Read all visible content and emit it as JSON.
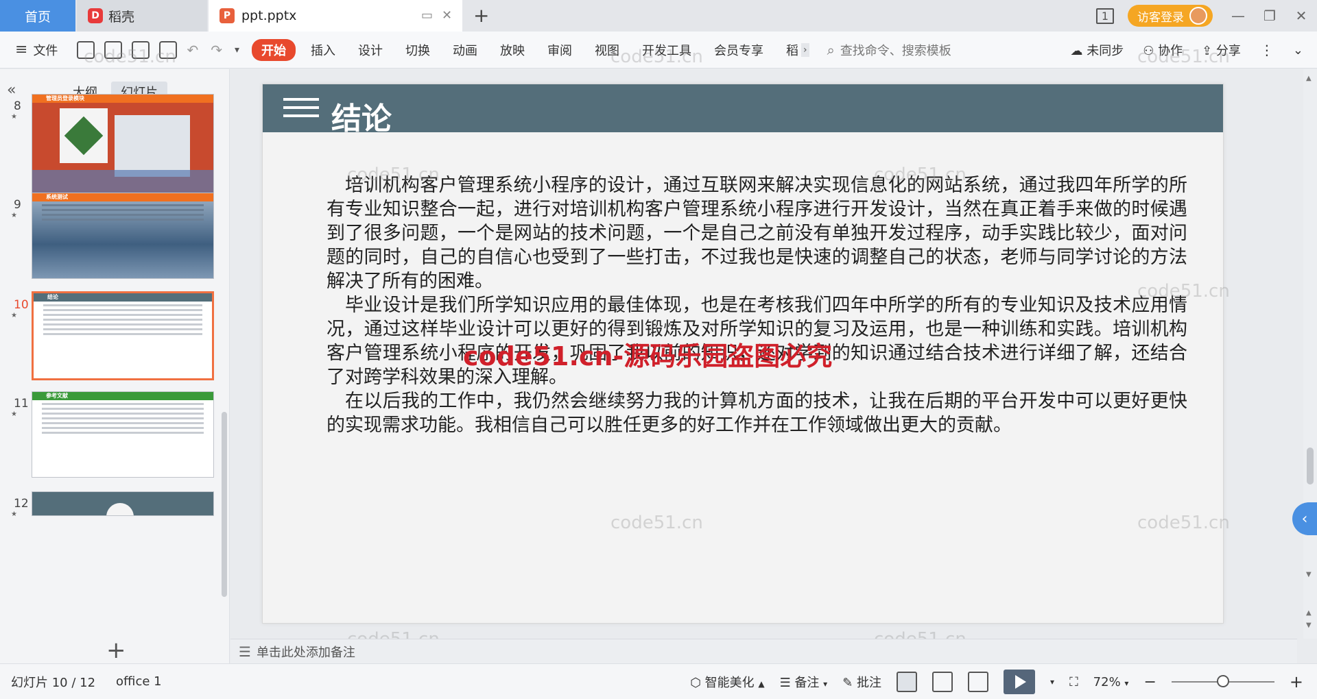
{
  "tabs": {
    "home": "首页",
    "daoke": "稻壳",
    "document": "ppt.pptx"
  },
  "titlebar": {
    "visitor_login": "访客登录",
    "page_indicator": "1"
  },
  "ribbon": {
    "file": "文件",
    "tabs": [
      "开始",
      "插入",
      "设计",
      "切换",
      "动画",
      "放映",
      "审阅",
      "视图",
      "开发工具",
      "会员专享",
      "稻"
    ],
    "search_placeholder": "查找命令、搜索模板",
    "sync": "未同步",
    "collab": "协作",
    "share": "分享"
  },
  "leftpanel": {
    "outline": "大纲",
    "slides": "幻灯片",
    "thumbs": [
      {
        "num": "8",
        "title": "管理员登录模块",
        "bar_color": "#f07020"
      },
      {
        "num": "9",
        "title": "系统测试",
        "bar_color": "#f07020"
      },
      {
        "num": "10",
        "title": "结论",
        "bar_color": "#546e7a"
      },
      {
        "num": "11",
        "title": "参考文献",
        "bar_color": "#3a9a3a"
      },
      {
        "num": "12",
        "title": "",
        "bar_color": "#546e7a"
      }
    ]
  },
  "slide": {
    "title": "结论",
    "paragraphs": [
      "培训机构客户管理系统小程序的设计，通过互联网来解决实现信息化的网站系统，通过我四年所学的所有专业知识整合一起，进行对培训机构客户管理系统小程序进行开发设计，当然在真正着手来做的时候遇到了很多问题，一个是网站的技术问题，一个是自己之前没有单独开发过程序，动手实践比较少，面对问题的同时，自己的自信心也受到了一些打击，不过我也是快速的调整自己的状态，老师与同学讨论的方法解决了所有的困难。",
      "毕业设计是我们所学知识应用的最佳体现，也是在考核我们四年中所学的所有的专业知识及技术应用情况，通过这样毕业设计可以更好的得到锻炼及对所学知识的复习及运用，也是一种训练和实践。培训机构客户管理系统小程序的开发，巩固了我以前的知识，还对学到的知识通过结合技术进行详细了解，还结合了对跨学科效果的深入理解。",
      "在以后我的工作中，我仍然会继续努力我的计算机方面的技术，让我在后期的平台开发中可以更好更快的实现需求功能。我相信自己可以胜任更多的好工作并在工作领域做出更大的贡献。"
    ],
    "overlay_watermark": "code51.cn-源码乐园盗图必究"
  },
  "notes_placeholder": "单击此处添加备注",
  "watermark_text": "code51.cn",
  "statusbar": {
    "slide_count": "幻灯片 10 / 12",
    "theme": "office 1",
    "beautify": "智能美化",
    "notes": "备注",
    "comment": "批注",
    "zoom": "72%"
  }
}
